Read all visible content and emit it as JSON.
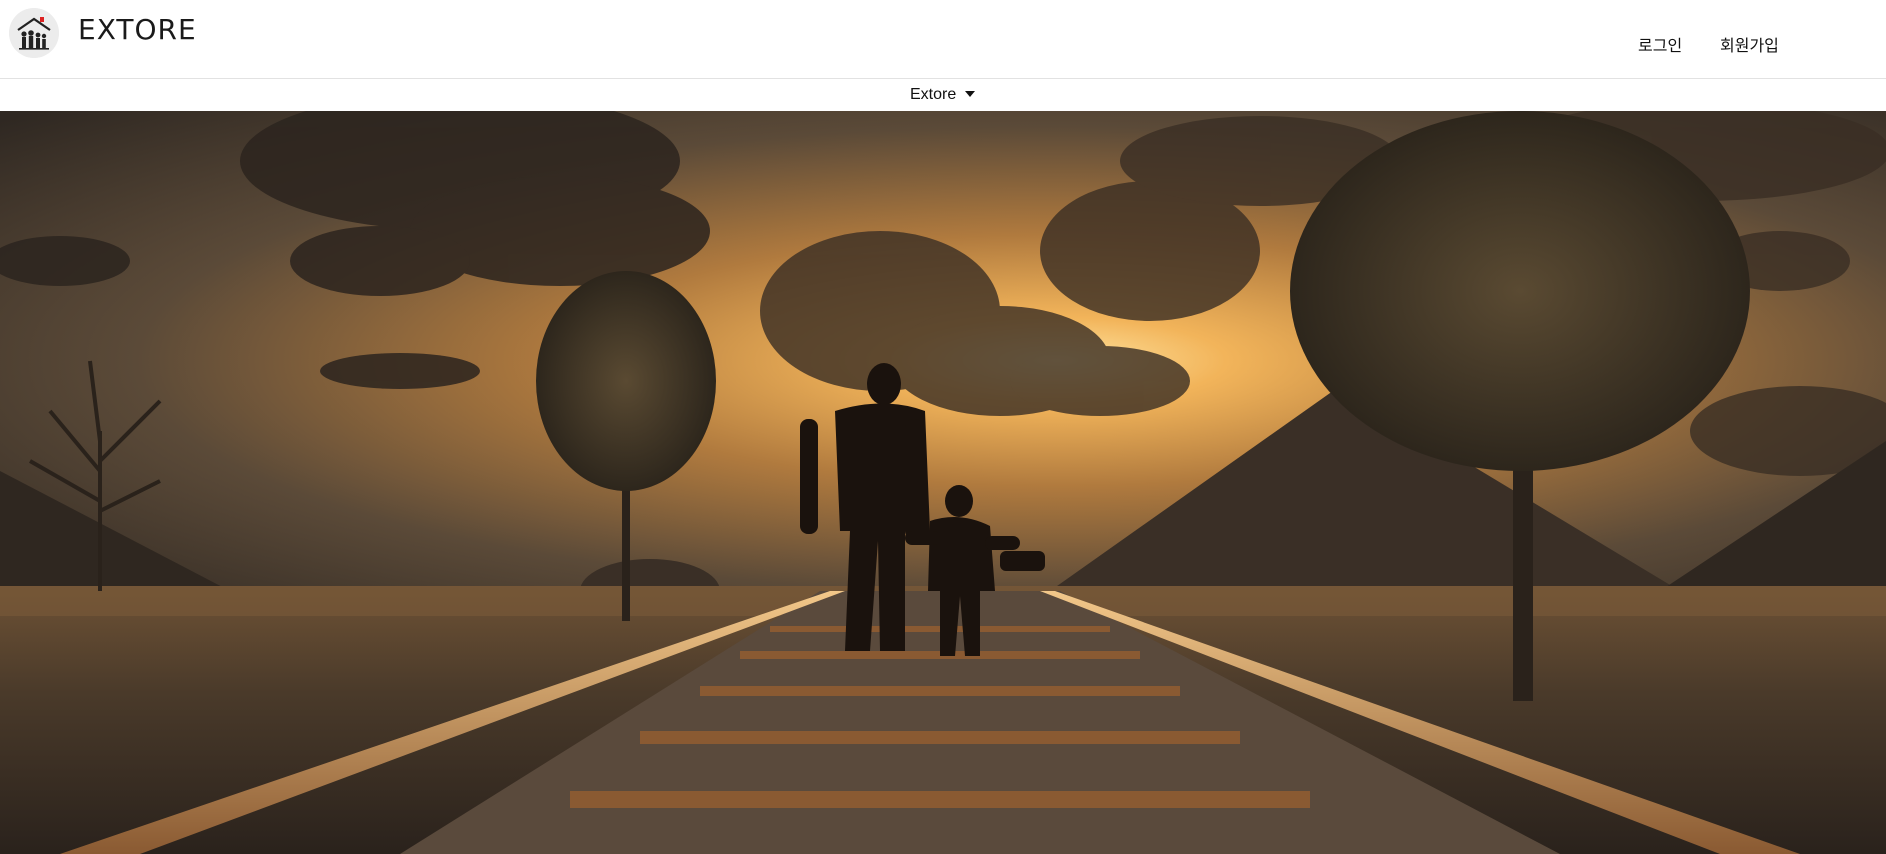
{
  "header": {
    "brand": "EXTORE",
    "logo_icon": "family-house-logo-icon",
    "nav": {
      "login": "로그인",
      "signup": "회원가입"
    }
  },
  "subnav": {
    "dropdown_label": "Extore",
    "dropdown_icon": "caret-down-icon"
  },
  "hero": {
    "scene": "sunset-railroad-silhouette",
    "colors": {
      "sky_glow": "#f2b45a",
      "sky_dark": "#3b3026",
      "ground": "#4a3a2a",
      "rail": "#b07a45"
    }
  }
}
